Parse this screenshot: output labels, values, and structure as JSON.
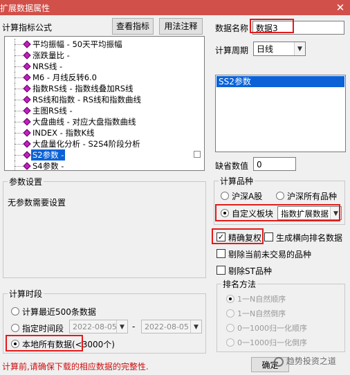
{
  "window": {
    "title": "扩展数据属性",
    "close_label": "✕"
  },
  "formula_panel": {
    "label": "计算指标公式",
    "view_indicator_button": "查看指标",
    "usage_notes_button": "用法注释",
    "items": [
      "平均振幅 - 50天平均振幅",
      "涨跌量比 -",
      "NRS线 -",
      "M6 - 月线反转6.0",
      "指数RS线 - 指数线叠加RS线",
      "RS线和指数 - RS线和指数曲线",
      "主图RS线 -",
      "大盘曲线 - 对应大盘指数曲线",
      "INDEX - 指数K线",
      "大盘量化分析 - S2S4阶段分析",
      "S2参数 -",
      "S4参数 -"
    ],
    "selected_index": 10
  },
  "data_name": {
    "label": "数据名称",
    "value": "数据3"
  },
  "period": {
    "label": "计算周期",
    "value": "日线"
  },
  "param_list": {
    "items": [
      "SS2参数"
    ],
    "selected": "SS2参数"
  },
  "default_value": {
    "label": "缺省数值",
    "value": "0"
  },
  "param_settings": {
    "title": "参数设置",
    "message": "无参数需要设置"
  },
  "varieties": {
    "title": "计算品种",
    "options": [
      "沪深A股",
      "沪深所有品种",
      "自定义板块"
    ],
    "selected": "自定义板块",
    "custom_block_value": "指数扩展数据"
  },
  "options": {
    "precise_adjust": {
      "label": "精确复权",
      "checked": true
    },
    "generate_rank": {
      "label": "生成横向排名数据",
      "checked": false
    },
    "exclude_untraded": {
      "label": "剔除当前未交易的品种",
      "checked": false
    },
    "exclude_st": {
      "label": "剔除ST品种",
      "checked": false
    }
  },
  "ranking": {
    "title": "排名方法",
    "options": [
      "1一N自然顺序",
      "1一N自然倒序",
      "0一1000归一化顺序",
      "0一1000归一化倒序"
    ],
    "selected": "1一N自然顺序"
  },
  "period_group": {
    "title": "计算时段",
    "opt_recent": "计算最近500条数据",
    "opt_range": "指定时间段",
    "date_from": "2022-08-05",
    "date_sep": "-",
    "date_to": "2022-08-05",
    "opt_local": "本地所有数据(<3000个)",
    "selected": "本地所有数据(<3000个)"
  },
  "footer": {
    "warning": "计算前,请确保下载的相应数据的完整性.",
    "ok_button": "确定",
    "watermark": "趋势投资之道"
  },
  "colors": {
    "titlebar": "#d1504a",
    "highlight": "#e21a1a",
    "selection": "#0b62d6",
    "warning": "#cc1010"
  }
}
